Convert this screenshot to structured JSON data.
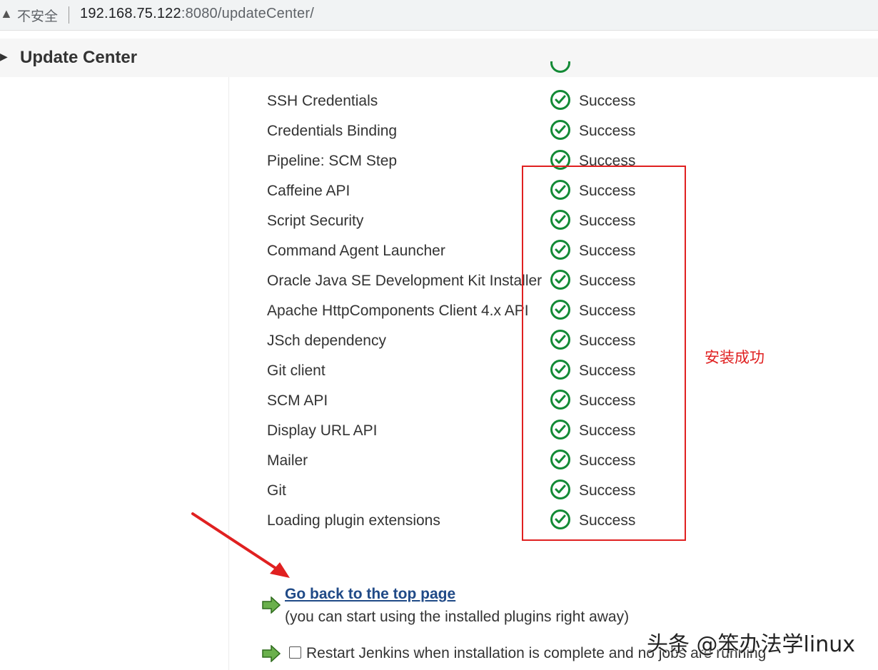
{
  "browser": {
    "insecure_label": "不安全",
    "url_host": "192.168.75.122",
    "url_rest": ":8080/updateCenter/"
  },
  "header": {
    "title": "Update Center"
  },
  "plugins": [
    {
      "name": "SSH Credentials",
      "status": "Success"
    },
    {
      "name": "Credentials Binding",
      "status": "Success"
    },
    {
      "name": "Pipeline: SCM Step",
      "status": "Success"
    },
    {
      "name": "Caffeine API",
      "status": "Success"
    },
    {
      "name": "Script Security",
      "status": "Success"
    },
    {
      "name": "Command Agent Launcher",
      "status": "Success"
    },
    {
      "name": "Oracle Java SE Development Kit Installer",
      "status": "Success"
    },
    {
      "name": "Apache HttpComponents Client 4.x API",
      "status": "Success"
    },
    {
      "name": "JSch dependency",
      "status": "Success"
    },
    {
      "name": "Git client",
      "status": "Success"
    },
    {
      "name": "SCM API",
      "status": "Success"
    },
    {
      "name": "Display URL API",
      "status": "Success"
    },
    {
      "name": "Mailer",
      "status": "Success"
    },
    {
      "name": "Git",
      "status": "Success"
    },
    {
      "name": "Loading plugin extensions",
      "status": "Success"
    }
  ],
  "annotation": {
    "text": "安装成功",
    "color": "#e02020"
  },
  "footer": {
    "go_back_label": "Go back to the top page",
    "go_back_note": "(you can start using the installed plugins right away)",
    "restart_label": "Restart Jenkins when installation is complete and no jobs are running",
    "restart_checked": false
  },
  "watermark": "头条 @笨办法学linux",
  "colors": {
    "success_green": "#138a36",
    "link_blue": "#204a87",
    "annotation_red": "#e02020"
  }
}
